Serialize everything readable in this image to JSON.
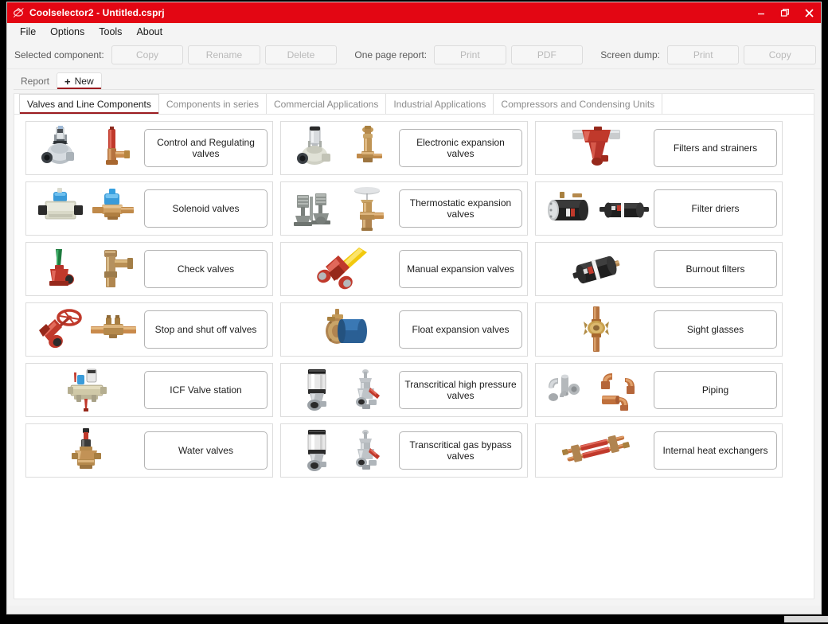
{
  "window": {
    "title": "Coolselector2 - Untitled.csprj",
    "app_icon": "app-logo-icon",
    "controls": {
      "minimize": "minimize-icon",
      "restore": "restore-icon",
      "close": "close-icon"
    },
    "accent_color": "#e30613",
    "tab_underline_color": "#9b1b20"
  },
  "menu": {
    "items": [
      {
        "label": "File"
      },
      {
        "label": "Options"
      },
      {
        "label": "Tools"
      },
      {
        "label": "About"
      }
    ]
  },
  "toolbar": {
    "selected_component_label": "Selected component:",
    "selected_component_buttons": [
      {
        "label": "Copy",
        "enabled": false
      },
      {
        "label": "Rename",
        "enabled": false
      },
      {
        "label": "Delete",
        "enabled": false
      }
    ],
    "one_page_report_label": "One page report:",
    "one_page_report_buttons": [
      {
        "label": "Print",
        "enabled": false
      },
      {
        "label": "PDF",
        "enabled": false
      }
    ],
    "screen_dump_label": "Screen dump:",
    "screen_dump_buttons": [
      {
        "label": "Print",
        "enabled": false
      },
      {
        "label": "Copy",
        "enabled": false
      }
    ]
  },
  "report_tabs": {
    "items": [
      {
        "label": "Report",
        "active": false,
        "has_plus": false
      },
      {
        "label": "New",
        "active": true,
        "has_plus": true,
        "plus": "+"
      }
    ]
  },
  "category_tabs": {
    "items": [
      {
        "label": "Valves and Line Components",
        "active": true
      },
      {
        "label": "Components in series",
        "active": false
      },
      {
        "label": "Commercial Applications",
        "active": false
      },
      {
        "label": "Industrial Applications",
        "active": false
      },
      {
        "label": "Compressors and Condensing Units",
        "active": false
      }
    ]
  },
  "cards": {
    "columns": [
      {
        "items": [
          {
            "label": "Control and Regulating valves",
            "images": [
              "grey-motor-valve-thumb",
              "copper-red-valve-thumb"
            ]
          },
          {
            "label": "Solenoid valves",
            "images": [
              "blue-coil-solenoid-thumb",
              "blue-coil-brass-solenoid-thumb"
            ]
          },
          {
            "label": "Check valves",
            "images": [
              "red-green-check-valve-thumb",
              "brass-angle-check-valve-thumb"
            ]
          },
          {
            "label": "Stop and shut off valves",
            "images": [
              "red-handwheel-stop-valve-thumb",
              "brass-inline-shutoff-thumb"
            ]
          },
          {
            "label": "ICF Valve station",
            "images": [
              "icf-valve-station-thumb"
            ]
          },
          {
            "label": "Water valves",
            "images": [
              "brass-water-valve-thumb"
            ]
          }
        ]
      },
      {
        "items": [
          {
            "label": "Electronic expansion valves",
            "images": [
              "electronic-actuator-valve-thumb",
              "brass-electronic-valve-thumb"
            ]
          },
          {
            "label": "Thermostatic expansion valves",
            "images": [
              "twin-thermostatic-valve-thumb",
              "brass-txv-thumb"
            ]
          },
          {
            "label": "Manual expansion valves",
            "images": [
              "yellow-handle-manual-valve-thumb"
            ]
          },
          {
            "label": "Float expansion valves",
            "images": [
              "blue-float-valve-thumb"
            ]
          },
          {
            "label": "Transcritical high pressure valves",
            "images": [
              "transcritical-actuator-thumb",
              "transcritical-valve-body-thumb"
            ]
          },
          {
            "label": "Transcritical gas bypass valves",
            "images": [
              "transcritical-actuator-thumb",
              "transcritical-valve-body-thumb"
            ]
          }
        ]
      },
      {
        "items": [
          {
            "label": "Filters and strainers",
            "images": [
              "red-y-strainer-thumb"
            ]
          },
          {
            "label": "Filter driers",
            "images": [
              "black-flanged-drier-thumb",
              "black-inline-drier-thumb"
            ]
          },
          {
            "label": "Burnout filters",
            "images": [
              "burnout-filter-thumb"
            ]
          },
          {
            "label": "Sight glasses",
            "images": [
              "copper-sight-glass-thumb"
            ]
          },
          {
            "label": "Piping",
            "images": [
              "steel-fittings-thumb",
              "copper-fittings-thumb"
            ]
          },
          {
            "label": "Internal heat exchangers",
            "images": [
              "internal-heat-exchanger-thumb"
            ]
          }
        ]
      }
    ]
  }
}
